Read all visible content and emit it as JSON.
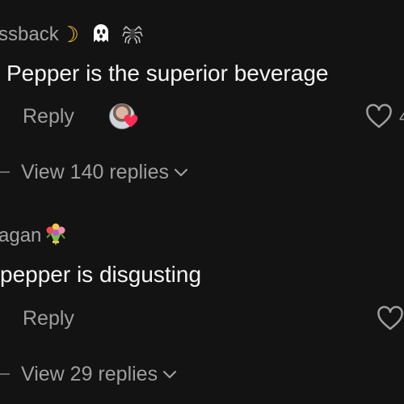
{
  "comments": [
    {
      "username": "ssback",
      "username_emojis": [
        "crescent-moon",
        "ghost",
        "spider"
      ],
      "text": "Pepper is the superior beverage",
      "reply_label": "Reply",
      "liked_by_creator": true,
      "like_count": "4",
      "view_replies_label": "View 140 replies"
    },
    {
      "username": "agan",
      "username_emojis": [
        "bouquet"
      ],
      "text": "pepper is disgusting",
      "reply_label": "Reply",
      "liked_by_creator": false,
      "like_count": "",
      "view_replies_label": "View 29 replies"
    }
  ],
  "colors": {
    "background": "#131313",
    "primary_text": "#f5f5f5",
    "secondary_text": "#9e9e9e",
    "heart_badge": "#fe2c55"
  }
}
